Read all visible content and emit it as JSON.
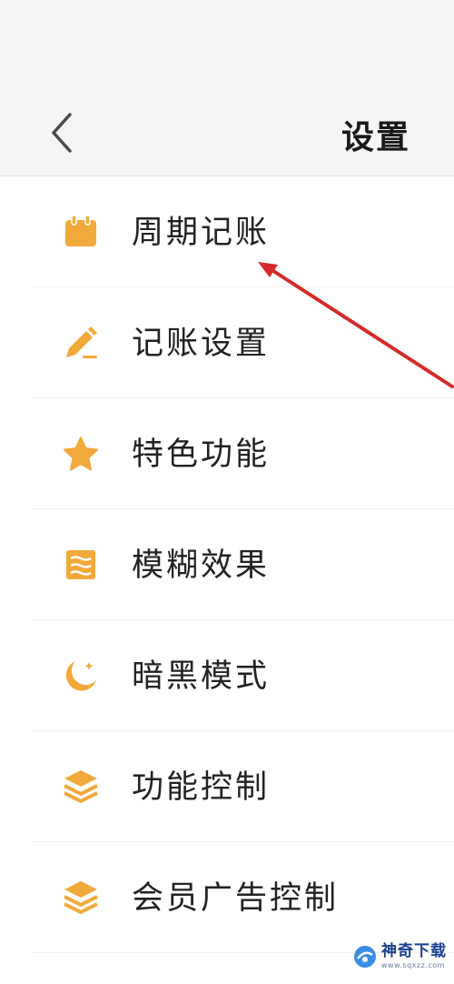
{
  "header": {
    "title": "设置"
  },
  "colors": {
    "accent": "#f2a93b",
    "arrow": "#d62a2a"
  },
  "items": [
    {
      "label": "周期记账",
      "icon": "calendar-icon"
    },
    {
      "label": "记账设置",
      "icon": "pencil-icon"
    },
    {
      "label": "特色功能",
      "icon": "star-icon"
    },
    {
      "label": "模糊效果",
      "icon": "blur-icon"
    },
    {
      "label": "暗黑模式",
      "icon": "moon-icon"
    },
    {
      "label": "功能控制",
      "icon": "layers-icon"
    },
    {
      "label": "会员广告控制",
      "icon": "layers-icon"
    }
  ],
  "watermark": {
    "brand": "神奇下载",
    "url": "www.sqxzz.com"
  }
}
